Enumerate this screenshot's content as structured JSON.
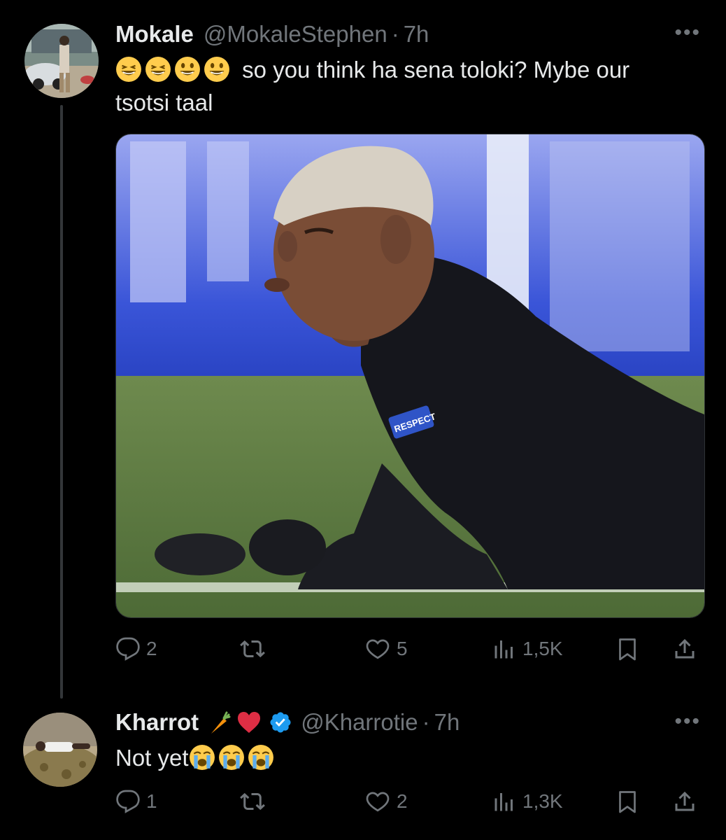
{
  "tweets": [
    {
      "display_name": "Mokale",
      "handle": "@MokaleStephen",
      "separator": "·",
      "time": "7h",
      "text": "so you think ha sena toloki? Mybe our tsotsi taal",
      "emojis": [
        "grinning-squinting-face",
        "grinning-squinting-face",
        "grinning-face",
        "grinning-face"
      ],
      "media_text": "RESPECT",
      "replies": "2",
      "reposts": "",
      "likes": "5",
      "views": "1,5K"
    },
    {
      "display_name": "Kharrot",
      "name_emojis": [
        "carrot",
        "red-heart"
      ],
      "verified": true,
      "handle": "@Kharrotie",
      "separator": "·",
      "time": "7h",
      "text": "Not yet",
      "emojis": [
        "loudly-crying-face",
        "loudly-crying-face",
        "loudly-crying-face"
      ],
      "replies": "1",
      "reposts": "",
      "likes": "2",
      "views": "1,3K"
    }
  ],
  "more_label": "•••",
  "colors": {
    "background": "#000000",
    "text": "#e7e9ea",
    "secondary": "#71767b",
    "verified": "#1d9bf0",
    "thread_line": "#333639"
  }
}
